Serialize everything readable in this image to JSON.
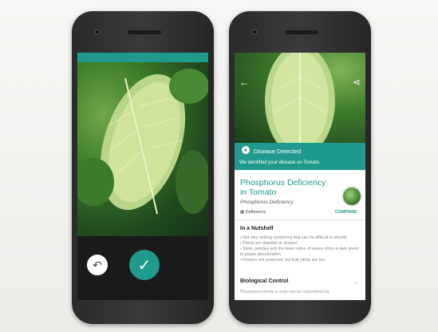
{
  "colors": {
    "teal": "#1f9a8c"
  },
  "left_phone": {
    "retake_icon": "undo-icon",
    "confirm_icon": "check-icon"
  },
  "right_phone": {
    "banner_title": "Disease Detected",
    "banner_subtitle": "We identified your disease on Tomato.",
    "title": "Phosphorus Deficiency in Tomato",
    "subtitle": "Phosphorus Deficiency",
    "tag": "Deficiency",
    "compare_label": "COMPARE",
    "section1": "In a Nutshell",
    "bullets": [
      "• Not very striking symptoms that can be difficult to identify",
      "• Plants are dwarfed or stunted",
      "• Stem, petioles and the lower sides of leaves show a dark green to purple discoloration",
      "• Flowers are produced, but fruit yields are low"
    ],
    "section2": "Biological Control",
    "trailing_text": "Phosphorus levels in soils can be replenished by"
  }
}
